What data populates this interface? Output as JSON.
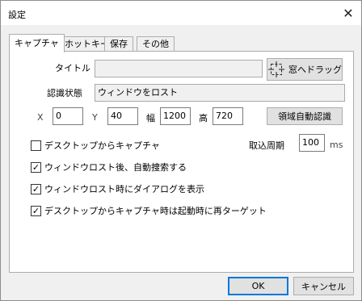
{
  "window": {
    "title": "設定",
    "close_glyph": "✕"
  },
  "tabs": [
    {
      "label": "キャプチャ",
      "active": true
    },
    {
      "label": "ホットキー",
      "active": false
    },
    {
      "label": "保存",
      "active": false
    },
    {
      "label": "その他",
      "active": false
    }
  ],
  "capture": {
    "title_label": "タイトル",
    "title_value": "",
    "drag_button_label": "窓へドラッグ",
    "status_label": "認識状態",
    "status_value": "ウィンドウをロスト",
    "x_label": "X",
    "x_value": "0",
    "y_label": "Y",
    "y_value": "40",
    "width_label": "幅",
    "width_value": "1200",
    "height_label": "高",
    "height_value": "720",
    "auto_detect_label": "領域自動認識",
    "interval_label": "取込周期",
    "interval_value": "100",
    "interval_unit": "ms",
    "checkboxes": [
      {
        "label": "デスクトップからキャプチャ",
        "checked": false
      },
      {
        "label": "ウィンドウロスト後、自動捜索する",
        "checked": true
      },
      {
        "label": "ウィンドウロスト時にダイアログを表示",
        "checked": true
      },
      {
        "label": "デスクトップからキャプチャ時は起動時に再ターゲット",
        "checked": true
      }
    ]
  },
  "footer": {
    "ok_label": "OK",
    "cancel_label": "キャンセル"
  },
  "icons": {
    "close": "close-icon",
    "drag": "crosshair-drag-icon",
    "check": "checkmark-icon"
  }
}
